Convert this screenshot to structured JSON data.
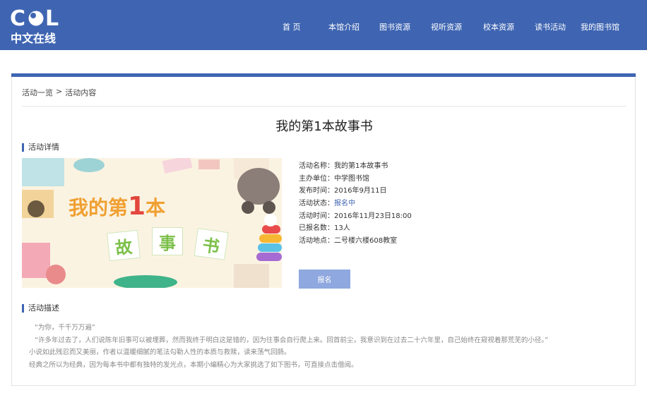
{
  "brand": {
    "logo_top": "COL",
    "logo_bottom": "中文在线",
    "colors": {
      "primary": "#3f65b2",
      "button": "#8fa8df",
      "status": "#3f65b2"
    }
  },
  "nav": {
    "items": [
      {
        "label": "首 页"
      },
      {
        "label": "本馆介绍"
      },
      {
        "label": "图书资源"
      },
      {
        "label": "视听资源"
      },
      {
        "label": "校本资源"
      },
      {
        "label": "读书活动"
      },
      {
        "label": "我的图书馆"
      }
    ]
  },
  "breadcrumb": {
    "items": [
      "活动一览",
      "活动内容"
    ],
    "separator": ">"
  },
  "page": {
    "title": "我的第1本故事书"
  },
  "detail": {
    "heading": "活动详情",
    "poster": {
      "line1_a": "我的第",
      "line1_num": "1",
      "line1_b": "本",
      "tiles": [
        "故",
        "事",
        "书"
      ]
    },
    "rows": [
      {
        "label": "活动名称：",
        "value": "我的第1本故事书"
      },
      {
        "label": "主办单位：",
        "value": "中学图书馆"
      },
      {
        "label": "发布时间：",
        "value": "2016年9月11日"
      },
      {
        "label": "活动状态：",
        "value": "报名中"
      },
      {
        "label": "活动时间：",
        "value": "2016年11月23日18:00"
      },
      {
        "label": "已报名数：",
        "value": "13人"
      },
      {
        "label": "活动地点：",
        "value": "二号楼六楼608教室"
      }
    ],
    "signup_label": "报名"
  },
  "description": {
    "heading": "活动描述",
    "lines": [
      "“为你，千千万万遍”",
      "“许多年过去了，人们说陈年旧事可以被埋葬，然而我终于明白这是错的，因为往事会自行爬上来。回首前尘，我意识到在过去二十六年里，自己始终在窥视着那荒芜的小径。”",
      "小说如此残忍而又美丽，作者以温暖细腻的笔法勾勒人性的本质与救赎，读来荡气回肠。",
      "经典之所以为经典，因为每本书中都有独特的发光点，本期小编精心为大家挑选了如下图书，可直接点击借阅。"
    ]
  }
}
